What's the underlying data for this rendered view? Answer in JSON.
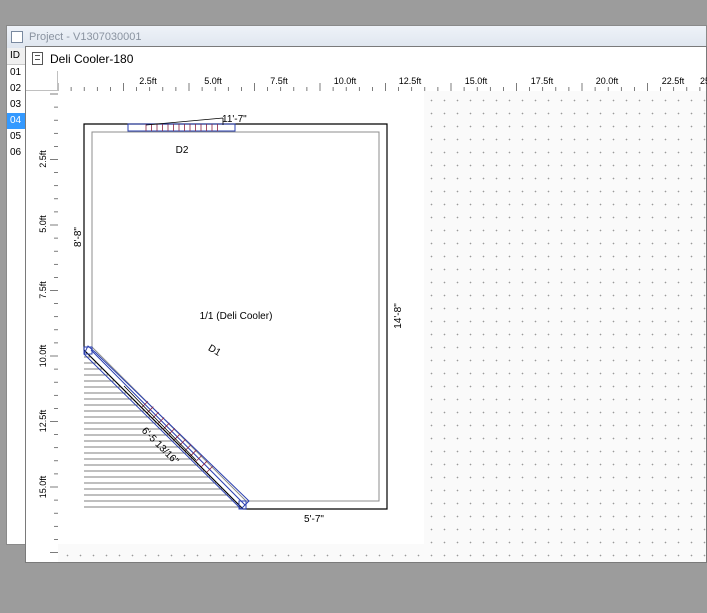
{
  "back_window": {
    "title": "Project - V1307030001",
    "column_header": "ID",
    "rows": [
      "01",
      "02",
      "03",
      "04",
      "05",
      "06"
    ],
    "selected_row": "04"
  },
  "window": {
    "title": "Deli Cooler-180"
  },
  "ruler": {
    "top_ticks": [
      "2.5ft",
      "5.0ft",
      "7.5ft",
      "10.0ft",
      "12.5ft",
      "15.0ft",
      "17.5ft",
      "20.0ft",
      "22.5ft",
      "25"
    ],
    "left_ticks": [
      "2.5ft",
      "5.0ft",
      "7.5ft",
      "10.0ft",
      "12.5ft",
      "15.0ft"
    ]
  },
  "plan": {
    "room_label": "1/1 (Deli Cooler)",
    "door1_label": "D1",
    "door2_label": "D2",
    "dims": {
      "top": "11'-7\"",
      "left": "8'-8\"",
      "right": "14'-8\"",
      "bottom": "5'-7\"",
      "diagonal": "6'-5 13/16\""
    },
    "colors": {
      "wall": "#000000",
      "inner_wall": "#8c8c8c",
      "door_frame": "#2a3fb0",
      "door_hatch": "#8b2040",
      "hatch": "#555555"
    }
  }
}
